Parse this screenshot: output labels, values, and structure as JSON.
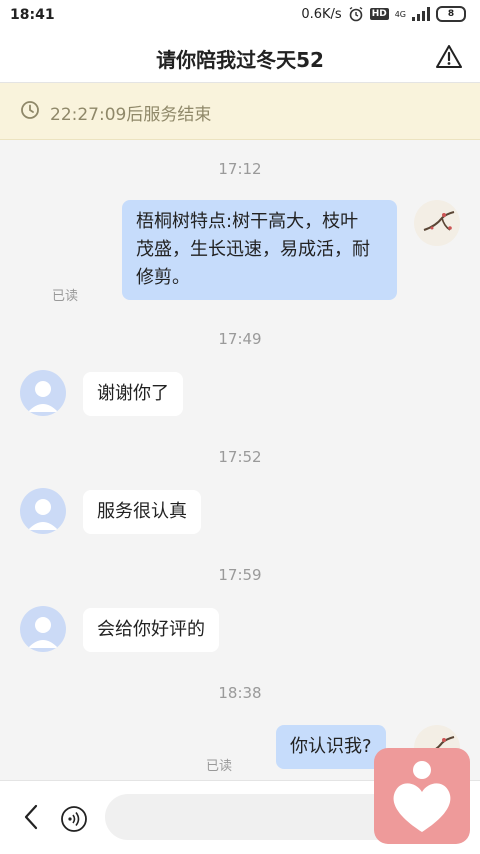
{
  "status_bar": {
    "time": "18:41",
    "speed": "0.6K/s",
    "network": "4G",
    "hd": "HD",
    "battery": "8"
  },
  "header": {
    "title": "请你陪我过冬天52"
  },
  "banner": {
    "text": "22:27:09后服务结束"
  },
  "messages": [
    {
      "time": "17:12",
      "side": "right",
      "text_lines": [
        "梧桐树特点:树干高大，枝叶",
        "茂盛，生长迅速，易成活，耐",
        "修剪。"
      ],
      "status": "已读"
    },
    {
      "time": "17:49",
      "side": "left",
      "text": "谢谢你了"
    },
    {
      "time": "17:52",
      "side": "left",
      "text": "服务很认真"
    },
    {
      "time": "17:59",
      "side": "left",
      "text": "会给你好评的"
    },
    {
      "time": "18:38",
      "side": "right",
      "text": "你认识我?",
      "status": "已读"
    }
  ],
  "input": {
    "placeholder": ""
  },
  "icons": {
    "back": "chevron-left-icon",
    "voice": "voice-icon",
    "warning": "warning-icon",
    "clock": "clock-icon",
    "fab": "heart-icon"
  },
  "colors": {
    "outgoing_bubble": "#c6dcfb",
    "incoming_bubble": "#ffffff",
    "banner_bg": "#f9f3dc",
    "fab": "#ee9a9a"
  }
}
